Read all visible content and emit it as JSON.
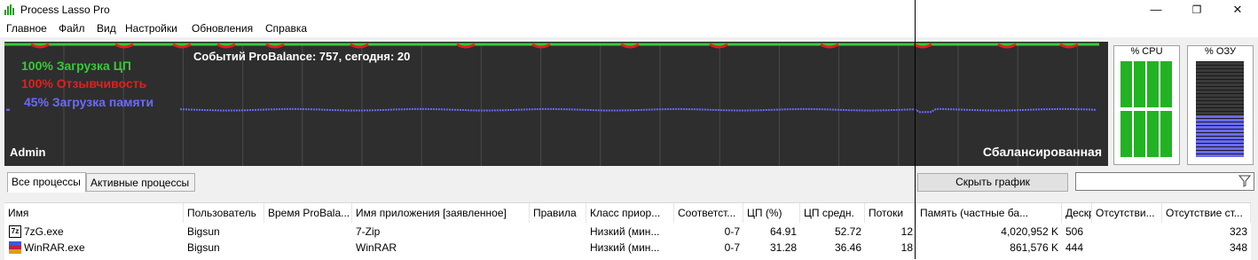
{
  "window": {
    "title": "Process Lasso Pro",
    "minimize": "—",
    "maximize": "❐",
    "close": "✕"
  },
  "menu": [
    "Главное",
    "Файл",
    "Вид",
    "Настройки",
    "Обновления",
    "Справка"
  ],
  "graph": {
    "cpu_label": "100% Загрузка ЦП",
    "responsiveness_label": "100% Отзывчивость",
    "memory_label": "45% Загрузка памяти",
    "probalance_events": "Событий ProBalance: 757, сегодня: 20",
    "user": "Admin",
    "power_plan": "Сбалансированная",
    "colors": {
      "cpu": "#38c938",
      "responsiveness": "#e02020",
      "memory": "#6a6aff",
      "background": "#2e2e2e",
      "event": "#ffffff"
    }
  },
  "meters": {
    "cpu_label": "% CPU",
    "ram_label": "% ОЗУ",
    "cpu_percent": 100,
    "ram_percent": 45
  },
  "tabs": [
    "Все процессы",
    "Активные процессы"
  ],
  "hide_graph_button": "Скрыть график",
  "filter_placeholder": "",
  "table": {
    "columns": [
      "Имя",
      "Пользователь",
      "Время ProBala...",
      "Имя приложения [заявленное]",
      "Правила",
      "Класс приор...",
      "Соответст...",
      "ЦП (%)",
      "ЦП средн.",
      "Потоки",
      "Память (частные ба...",
      "Дескр...",
      "Отсутстви...",
      "Отсутствие ст..."
    ],
    "rows": [
      {
        "icon": "7z-icon",
        "name": "7zG.exe",
        "user": "Bigsun",
        "probalance_time": "",
        "app_name": "7-Zip",
        "rules": "",
        "priority": "Низкий (мин...",
        "affinity": "0-7",
        "cpu": "64.91",
        "cpu_avg": "52.72",
        "threads": "12",
        "memory": "4,020,952 K",
        "handles": "506",
        "pf1": "",
        "pf2": "323"
      },
      {
        "icon": "winrar-icon",
        "name": "WinRAR.exe",
        "user": "Bigsun",
        "probalance_time": "",
        "app_name": "WinRAR",
        "rules": "",
        "priority": "Низкий (мин...",
        "affinity": "0-7",
        "cpu": "31.28",
        "cpu_avg": "36.46",
        "threads": "18",
        "memory": "861,576 K",
        "handles": "444",
        "pf1": "",
        "pf2": "348"
      }
    ]
  }
}
